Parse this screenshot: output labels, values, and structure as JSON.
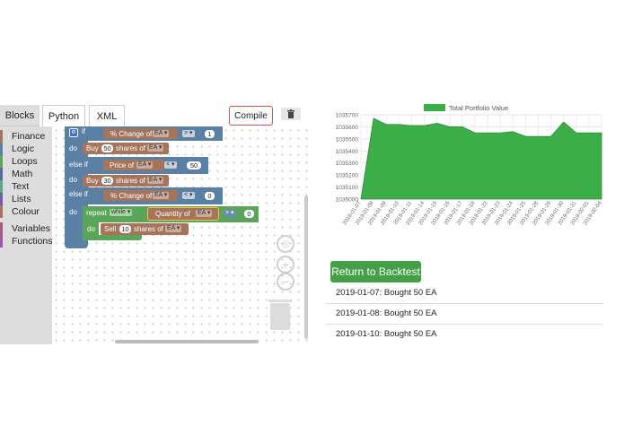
{
  "tabs": {
    "blocks": "Blocks",
    "python": "Python",
    "xml": "XML"
  },
  "toolbar": {
    "compile_label": "Compile",
    "trash_icon": "trash-icon"
  },
  "toolbox": {
    "categories": [
      {
        "label": "Finance",
        "color": "#a5745b"
      },
      {
        "label": "Logic",
        "color": "#5b80a5"
      },
      {
        "label": "Loops",
        "color": "#5ba55b"
      },
      {
        "label": "Math",
        "color": "#5b67a5"
      },
      {
        "label": "Text",
        "color": "#5ba58c"
      },
      {
        "label": "Lists",
        "color": "#745ba5"
      },
      {
        "label": "Colour",
        "color": "#a5745b"
      },
      {
        "label": "Variables",
        "color": "#a55b80"
      },
      {
        "label": "Functions",
        "color": "#995ba5"
      }
    ]
  },
  "blocks": {
    "if_kw": "if",
    "do_kw": "do",
    "elseif_kw": "else if",
    "repeat_kw": "repeat",
    "while_kw": "while",
    "pct_change": "% Change of",
    "price_of": "Price of",
    "quantity_of": "Quantity of",
    "ticker": "EA",
    "buy": "Buy",
    "sell": "Sell",
    "shares_of": "shares of",
    "op_gt": ">",
    "op_lt": "<",
    "val_1": "1",
    "val_50": "50",
    "val_30": "30",
    "val_0": "0",
    "val_10": "10"
  },
  "chart_data": {
    "type": "area",
    "legend": "Total Portfolio Value",
    "legend_position": "top",
    "color": "#3cae48",
    "x": [
      "2019-01-07",
      "2019-01-08",
      "2019-01-09",
      "2019-01-10",
      "2019-01-11",
      "2019-01-14",
      "2019-01-15",
      "2019-01-16",
      "2019-01-17",
      "2019-01-18",
      "2019-01-22",
      "2019-01-23",
      "2019-01-24",
      "2019-01-25",
      "2019-01-28",
      "2019-01-29",
      "2019-01-30",
      "2019-01-31",
      "2019-02-01",
      "2019-02-04"
    ],
    "values": [
      1035000,
      1035670,
      1035620,
      1035620,
      1035610,
      1035610,
      1035630,
      1035600,
      1035600,
      1035550,
      1035550,
      1035550,
      1035560,
      1035520,
      1035520,
      1035520,
      1035640,
      1035550,
      1035550,
      1035550
    ],
    "ylim": [
      1035000,
      1035700
    ],
    "yticks": [
      "1035700",
      "1035600",
      "1035500",
      "1035400",
      "1035300",
      "1035200",
      "1035100",
      "1035000"
    ],
    "grid": true
  },
  "return_label": "Return to Backtest",
  "transactions": [
    "2019-01-07: Bought 50 EA",
    "2019-01-08: Bought 50 EA",
    "2019-01-10: Bought 50 EA"
  ]
}
